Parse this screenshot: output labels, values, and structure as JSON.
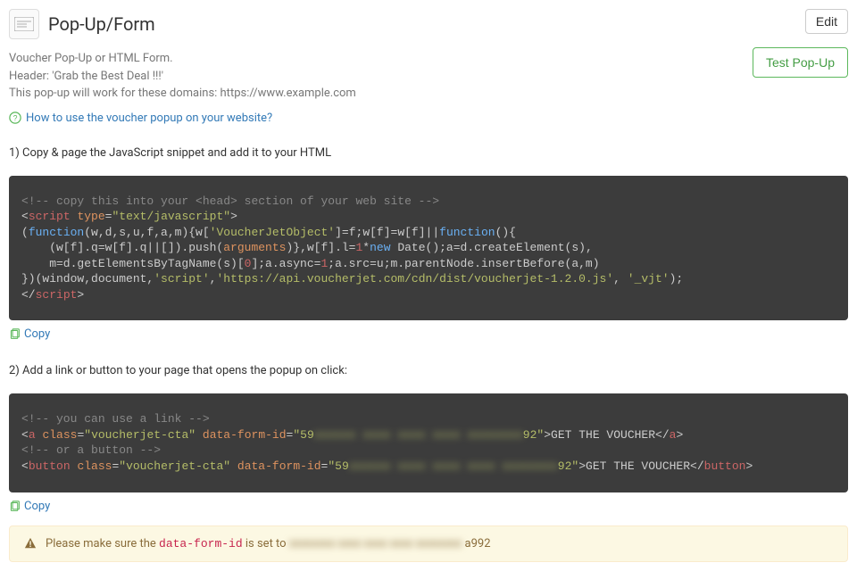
{
  "header": {
    "title": "Pop-Up/Form",
    "edit_label": "Edit",
    "test_label": "Test Pop-Up"
  },
  "description": {
    "line1": "Voucher Pop-Up or HTML Form.",
    "line2": "Header: 'Grab the Best Deal !!!'",
    "line3": "This pop-up will work for these domains: https://www.example.com"
  },
  "help": {
    "link_label": "How to use the voucher popup on your website?"
  },
  "steps": {
    "step1": "1) Copy & page the JavaScript snippet and add it to your HTML",
    "step2": "2) Add a link or button to your page that opens the popup on click:"
  },
  "copy_label": "Copy",
  "code1": {
    "comment_head": "<!-- copy this into your <head> section of your web site -->",
    "script_open_tag": "script",
    "type_attr": "type",
    "type_val": "\"text/javascript\"",
    "l3_a": "(",
    "l3_fn": "function",
    "l3_b": "(w,d,s,u,f,a,m){w[",
    "l3_str": "'VoucherJetObject'",
    "l3_c": "]=f;w[f]=w[f]||",
    "l3_fn2": "function",
    "l3_d": "(){",
    "l4_a": "    (w[f].q=w[f].q||[]).push(",
    "l4_arg": "arguments",
    "l4_b": ")},w[f].l=",
    "l4_num1": "1",
    "l4_c": "*",
    "l4_new": "new",
    "l4_d": " Date();a=d.createElement(s),",
    "l5_a": "    m=d.getElementsByTagName(s)[",
    "l5_num0": "0",
    "l5_b": "];a.async=",
    "l5_num1": "1",
    "l5_c": ";a.src=u;m.parentNode.insertBefore(a,m)",
    "l6_a": "})(window,document,",
    "l6_s1": "'script'",
    "l6_b": ",",
    "l6_s2": "'https://api.voucherjet.com/cdn/dist/voucherjet-1.2.0.js'",
    "l6_c": ", ",
    "l6_s3": "'_vjt'",
    "l6_d": ");",
    "script_close": "script"
  },
  "code2": {
    "c1": "<!-- you can use a link -->",
    "a_tag": "a",
    "class_attr": "class",
    "class_val": "\"voucherjet-cta\"",
    "dfi_attr": "data-form-id",
    "dfi_val_prefix": "\"59",
    "dfi_blur": "xxxxxx xxxx xxxx xxxx xxxxxxxx",
    "dfi_val_suffix_a": "92\"",
    "cta_text": "GET THE VOUCHER",
    "c2": "<!-- or a button -->",
    "btn_tag": "button",
    "dfi_val_suffix_b": "92\""
  },
  "alert": {
    "prefix": "Please make sure the ",
    "code": "data-form-id",
    "mid": " is set to ",
    "blur": "xxxxxxxx xxxx xxxx xxxx xxxxxxxx",
    "suffix": " a992"
  }
}
